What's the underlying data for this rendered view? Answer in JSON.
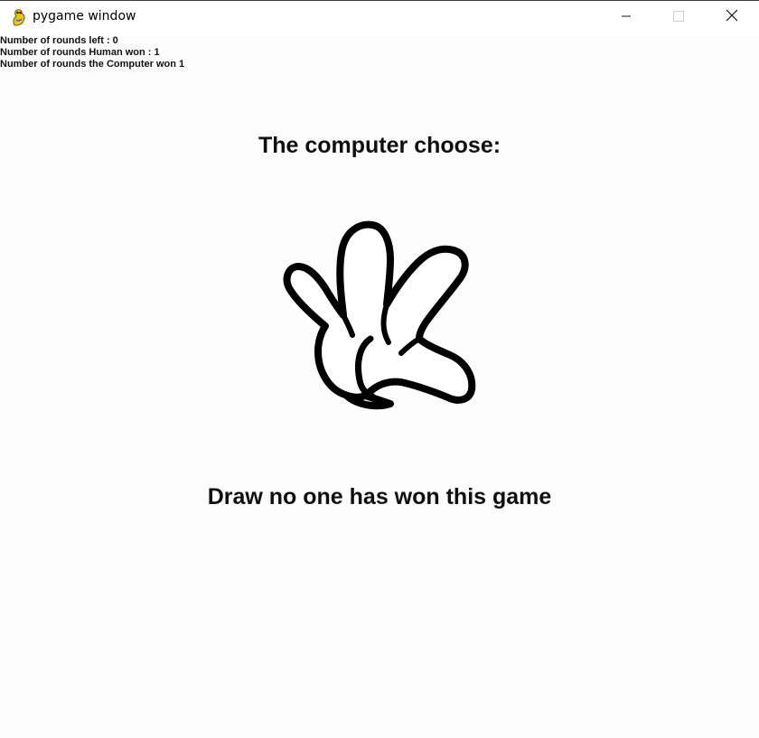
{
  "window": {
    "title": "pygame window",
    "icon": "pygame-snake-icon",
    "controls": [
      "minimize-icon",
      "maximize-icon",
      "close-icon"
    ]
  },
  "stats": {
    "rounds_left": "Number of rounds left : 0",
    "human_won": "Number of rounds Human won : 1",
    "computer_won": "Number of rounds the Computer won 1"
  },
  "game": {
    "computer_choice_label": "The computer choose:",
    "computer_choice": "paper",
    "computer_choice_icon": "open-hand-icon",
    "result": "Draw no one has won this game"
  },
  "colors": {
    "background": "#fdfdfd",
    "text": "#0f0f0f",
    "hand_outline": "#000000",
    "hand_fill": "#ffffff",
    "icon_yellow": "#f2c40f"
  }
}
